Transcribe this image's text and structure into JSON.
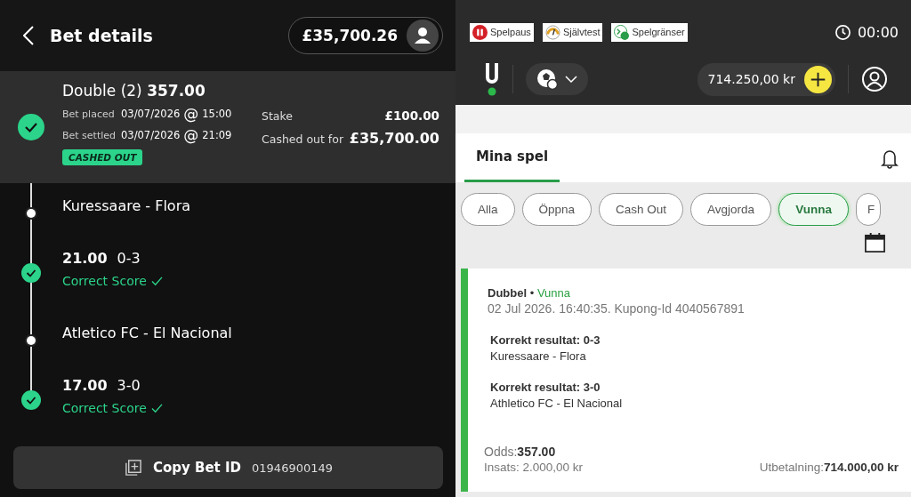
{
  "bet_details": {
    "title": "Bet details",
    "balance": "£35,700.26",
    "summary": {
      "title": "Double (2)",
      "odds": "357.00",
      "settled": true,
      "placed_label": "Bet placed",
      "placed_date": "03/07/2026",
      "placed_time": "15:00",
      "settled_label": "Bet settled",
      "settled_date": "03/07/2026",
      "settled_time": "21:09",
      "at": "@",
      "stake_label": "Stake",
      "stake": "£100.00",
      "cashout_label": "Cashed out for",
      "cashout": "£35,700.00",
      "badge": "CASHED OUT"
    },
    "timeline": [
      {
        "kind": "event",
        "text": "Kuressaare - Flora"
      },
      {
        "kind": "result",
        "odds": "21.00",
        "score": "0-3",
        "market": "Correct Score",
        "won": true
      },
      {
        "kind": "event",
        "text": "Atletico FC - El Nacional"
      },
      {
        "kind": "result",
        "odds": "17.00",
        "score": "3-0",
        "market": "Correct Score",
        "won": true
      }
    ],
    "copy_button": {
      "label": "Copy Bet ID",
      "id": "01946900149"
    }
  },
  "my_bets": {
    "badges": [
      {
        "kind": "pause",
        "label": "Spelpaus"
      },
      {
        "kind": "test",
        "label": "Självtest"
      },
      {
        "kind": "limits",
        "label": "Spelgränser"
      }
    ],
    "timer": "00:00",
    "wallet": "714.250,00 kr",
    "tab": {
      "label": "Mina spel",
      "selected": true
    },
    "filters": [
      {
        "label": "Alla",
        "selected": false
      },
      {
        "label": "Öppna",
        "selected": false
      },
      {
        "label": "Cash Out",
        "selected": false
      },
      {
        "label": "Avgjorda",
        "selected": false
      },
      {
        "label": "Vunna",
        "selected": true
      },
      {
        "label": "F",
        "selected": false
      }
    ],
    "card": {
      "type": "Dubbel",
      "separator": "•",
      "status": "Vunna",
      "won": true,
      "meta": "02 Jul 2026. 16:40:35. Kupong-Id 4040567891",
      "legs": [
        {
          "market": "Korrekt resultat: 0-3",
          "match": "Kuressaare - Flora"
        },
        {
          "market": "Korrekt resultat: 3-0",
          "match": "Athletico FC - El Nacional"
        }
      ],
      "odds_label": "Odds:",
      "odds": "357.00",
      "stake": "Insats: 2.000,00 kr",
      "payout_label": "Utbetalning:",
      "payout": "714.000,00 kr"
    }
  }
}
